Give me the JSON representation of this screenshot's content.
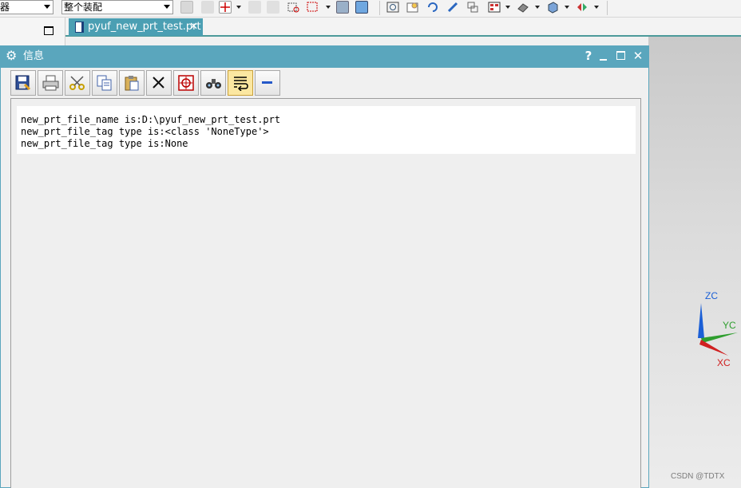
{
  "toolbar": {
    "combo_left_value": "器",
    "combo_assembly_value": "整个装配"
  },
  "file_tab": {
    "label": "pyuf_new_prt_test.prt",
    "close_glyph": "✕"
  },
  "dialog": {
    "title": "信息",
    "help_glyph": "?",
    "close_glyph": "✕",
    "toolbar_buttons": [
      "save",
      "print",
      "cut",
      "copy",
      "paste",
      "delete",
      "select",
      "find",
      "wrap",
      "minimize"
    ],
    "active_button": "wrap",
    "output_lines": [
      "new_prt_file_name is:D:\\pyuf_new_prt_test.prt",
      "new_prt_file_tag type is:<class 'NoneType'>",
      "new_prt_file_tag type is:None"
    ]
  },
  "triad": {
    "zc": "ZC",
    "yc": "YC",
    "xc": "XC",
    "zc_color": "#1b5fd6",
    "yc_color": "#2e9e2e",
    "xc_color": "#d02020"
  },
  "watermark": "CSDN @TDTX"
}
